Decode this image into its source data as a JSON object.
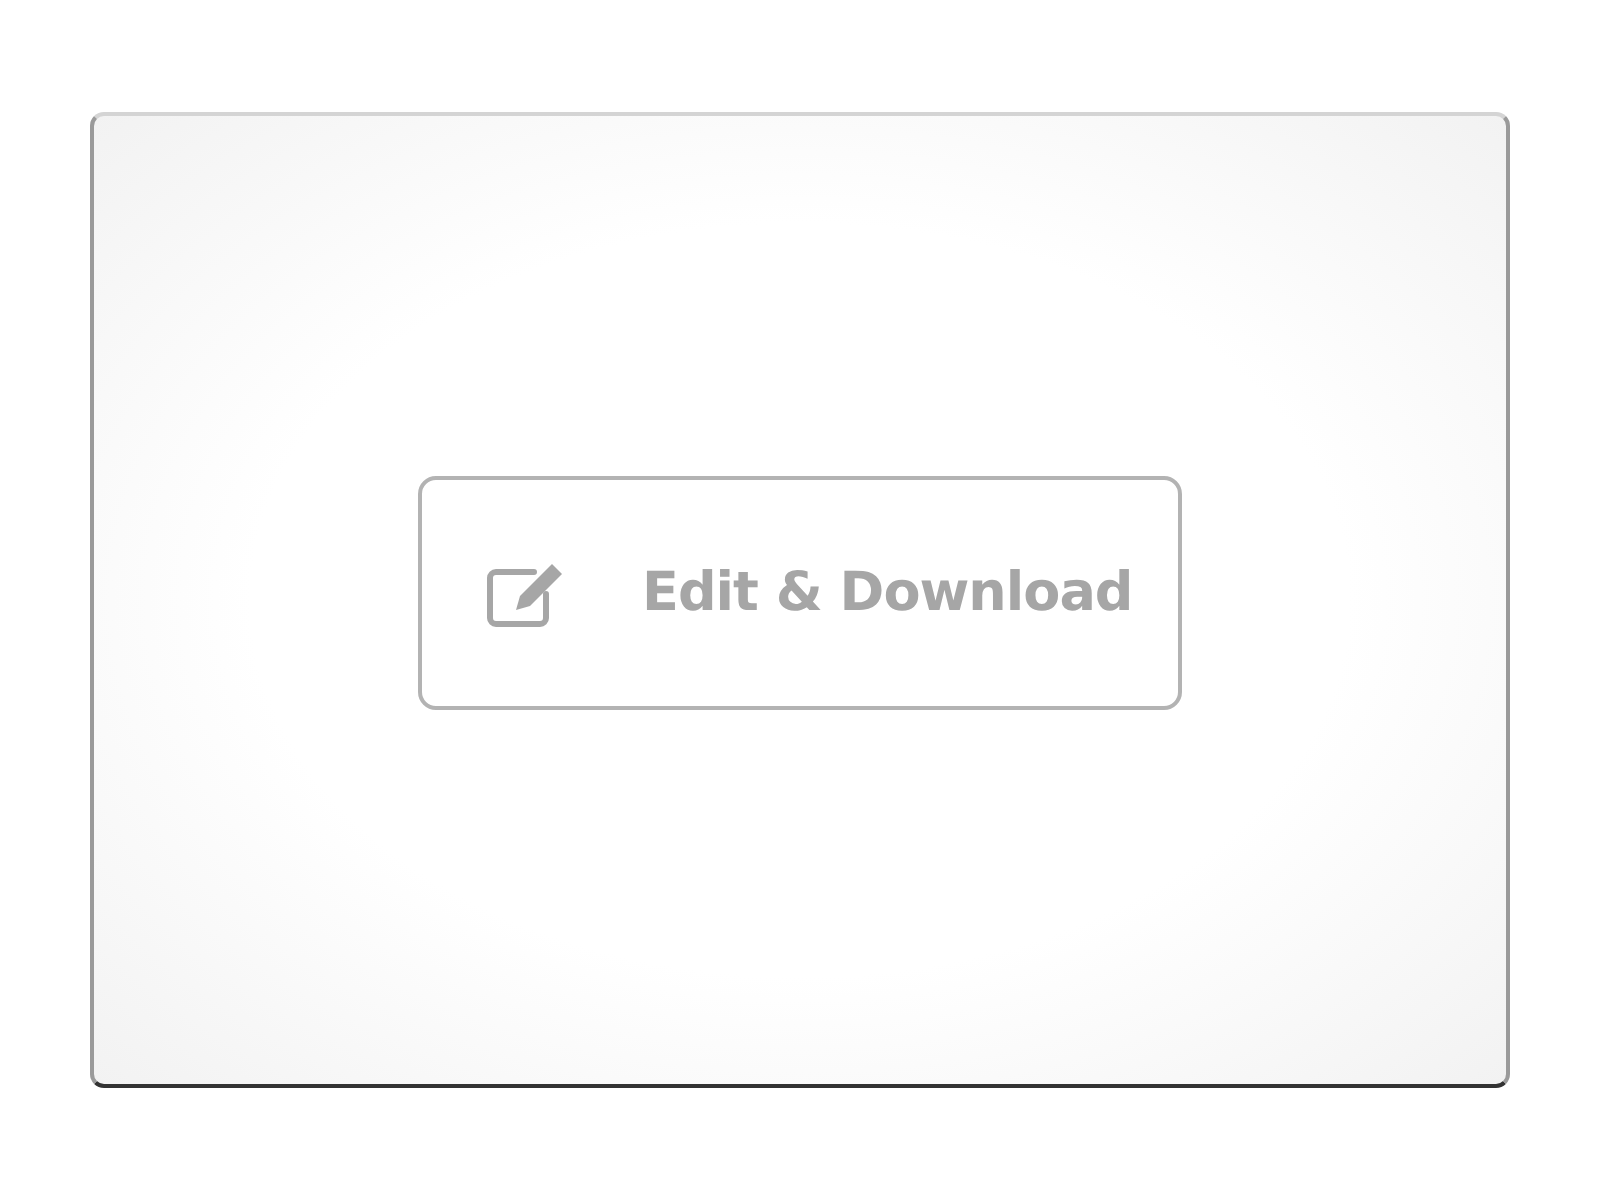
{
  "button": {
    "label": "Edit & Download"
  }
}
